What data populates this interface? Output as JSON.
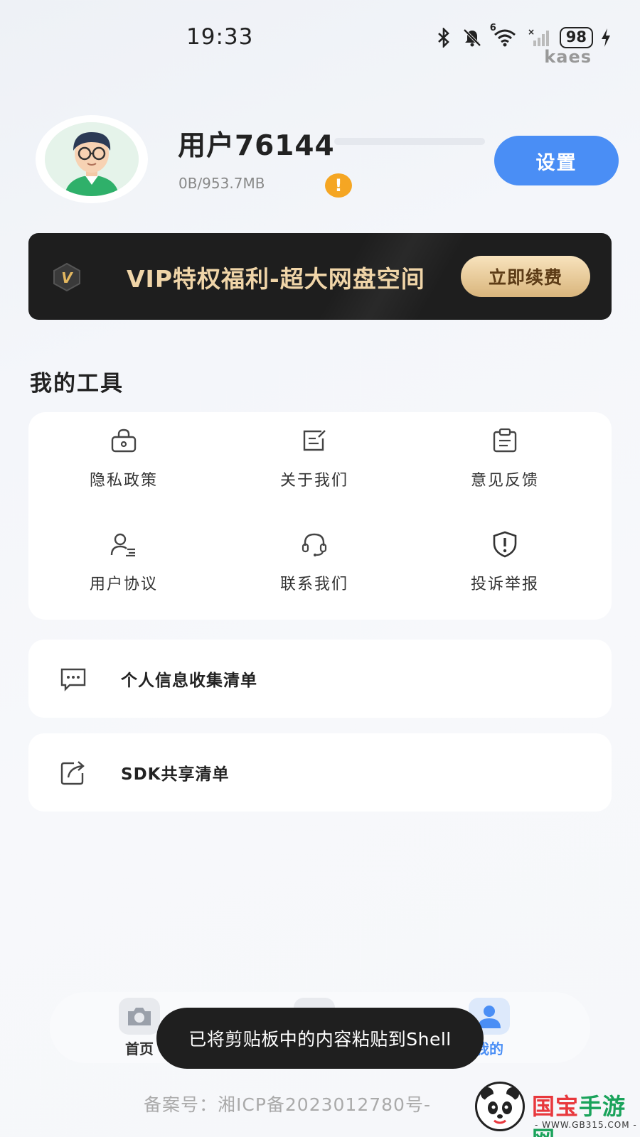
{
  "status_bar": {
    "time": "19:33",
    "battery": "98",
    "carrier_label": "kaes",
    "wifi_badge": "6",
    "icons": [
      "bluetooth-icon",
      "silent-icon",
      "wifi-icon",
      "signal-icon",
      "battery-icon",
      "charging-icon"
    ]
  },
  "profile": {
    "username": "用户76144",
    "storage": "0B/953.7MB",
    "storage_used_fraction": 0.0,
    "warning_glyph": "!",
    "settings_label": "设置"
  },
  "vip": {
    "badge": "V",
    "text": "VIP特权福利-超大网盘空间",
    "renew_label": "立即续费"
  },
  "tools": {
    "title": "我的工具",
    "items": [
      {
        "label": "隐私政策",
        "icon": "lock-icon"
      },
      {
        "label": "关于我们",
        "icon": "edit-document-icon"
      },
      {
        "label": "意见反馈",
        "icon": "clipboard-icon"
      },
      {
        "label": "用户协议",
        "icon": "user-list-icon"
      },
      {
        "label": "联系我们",
        "icon": "headset-icon"
      },
      {
        "label": "投诉举报",
        "icon": "shield-alert-icon"
      }
    ]
  },
  "list": [
    {
      "label": "个人信息收集清单",
      "icon": "message-dots-icon"
    },
    {
      "label": "SDK共享清单",
      "icon": "share-icon"
    }
  ],
  "bottom_nav": {
    "items": [
      {
        "label": "首页",
        "icon": "camera-icon"
      },
      {
        "label": "",
        "icon": "folder-icon"
      },
      {
        "label": "我的",
        "icon": "user-icon",
        "active": true
      }
    ]
  },
  "toast": "已将剪贴板中的内容粘贴到Shell",
  "footer": {
    "icp": "备案号：湘ICP备2023012780号-"
  },
  "watermark": {
    "brand_red": "国宝",
    "brand_green": "手游网",
    "url": "- WWW.GB315.COM -"
  },
  "colors": {
    "accent": "#4a8ef5",
    "vip_gold": "#f0d5a8",
    "warning": "#f5a623",
    "banner_bg": "#1e1e1e"
  }
}
